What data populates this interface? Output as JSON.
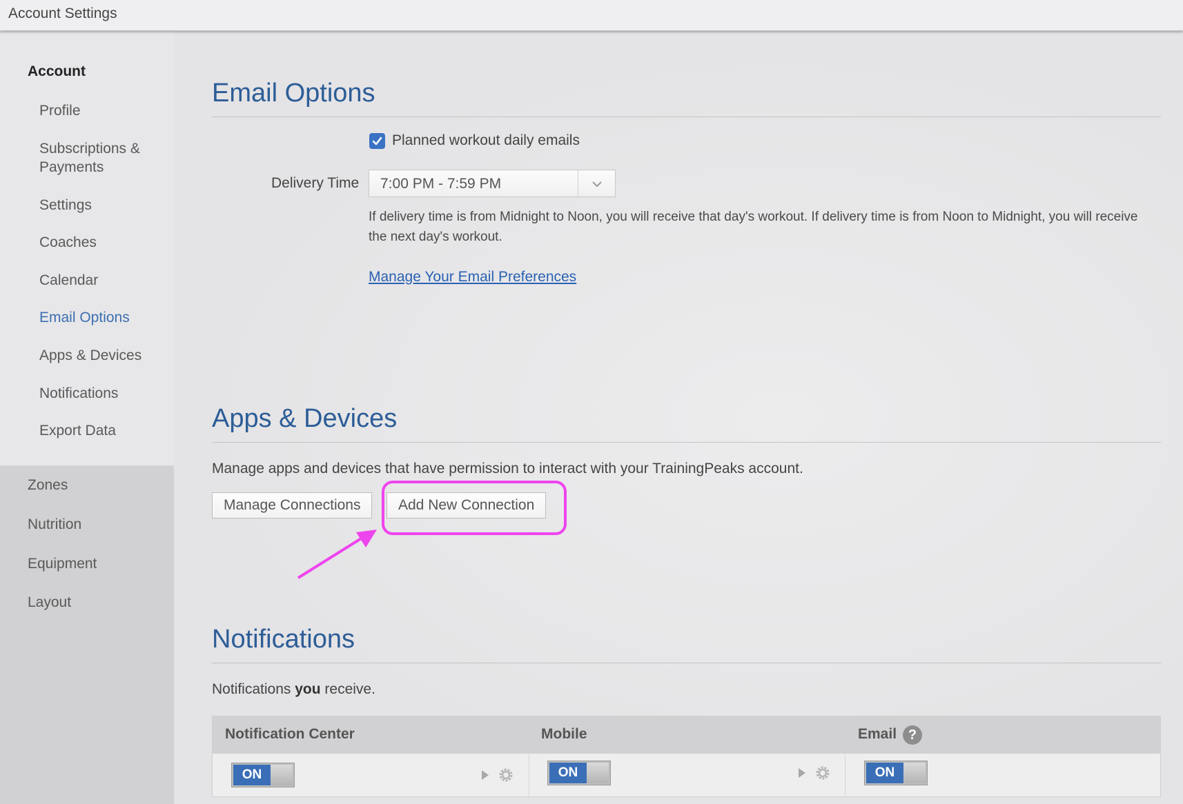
{
  "window": {
    "title": "Account Settings"
  },
  "sidebar": {
    "heading": "Account",
    "items": [
      {
        "label": "Profile"
      },
      {
        "label": "Subscriptions &"
      },
      {
        "label": "Payments"
      },
      {
        "label": "Settings"
      },
      {
        "label": "Coaches"
      },
      {
        "label": "Calendar"
      },
      {
        "label": "Email Options",
        "active": true
      },
      {
        "label": "Apps & Devices"
      },
      {
        "label": "Notifications"
      },
      {
        "label": "Export Data"
      }
    ],
    "groups": [
      {
        "label": "Zones"
      },
      {
        "label": "Nutrition"
      },
      {
        "label": "Equipment"
      },
      {
        "label": "Layout"
      }
    ]
  },
  "email_options": {
    "title": "Email Options",
    "checkbox_label": "Planned workout daily emails",
    "checked": true,
    "delivery_label": "Delivery Time",
    "delivery_value": "7:00 PM - 7:59 PM",
    "help_text": "If delivery time is from Midnight to Noon, you will receive that day's workout. If delivery time is from Noon to Midnight, you will receive the next day's workout.",
    "preferences_link": "Manage Your Email Preferences"
  },
  "apps_devices": {
    "title": "Apps & Devices",
    "description": "Manage apps and devices that have permission to interact with your TrainingPeaks account.",
    "manage_button": "Manage Connections",
    "add_button": "Add New Connection"
  },
  "notifications": {
    "title": "Notifications",
    "description_pre": "Notifications ",
    "description_bold": "you",
    "description_post": " receive.",
    "columns": [
      {
        "label": "Notification Center",
        "toggle": "ON"
      },
      {
        "label": "Mobile",
        "toggle": "ON"
      },
      {
        "label": "Email",
        "toggle": "ON"
      }
    ],
    "help_icon": "?"
  },
  "colors": {
    "accent": "#2c5d97",
    "link": "#2a61b3",
    "toggle_on": "#3a6fb7",
    "annotation": "#ee44ee"
  },
  "icons": [
    "check-icon",
    "chevron-down-icon",
    "caret-right-icon",
    "gear-icon",
    "help-icon",
    "annotation-arrow-icon"
  ]
}
